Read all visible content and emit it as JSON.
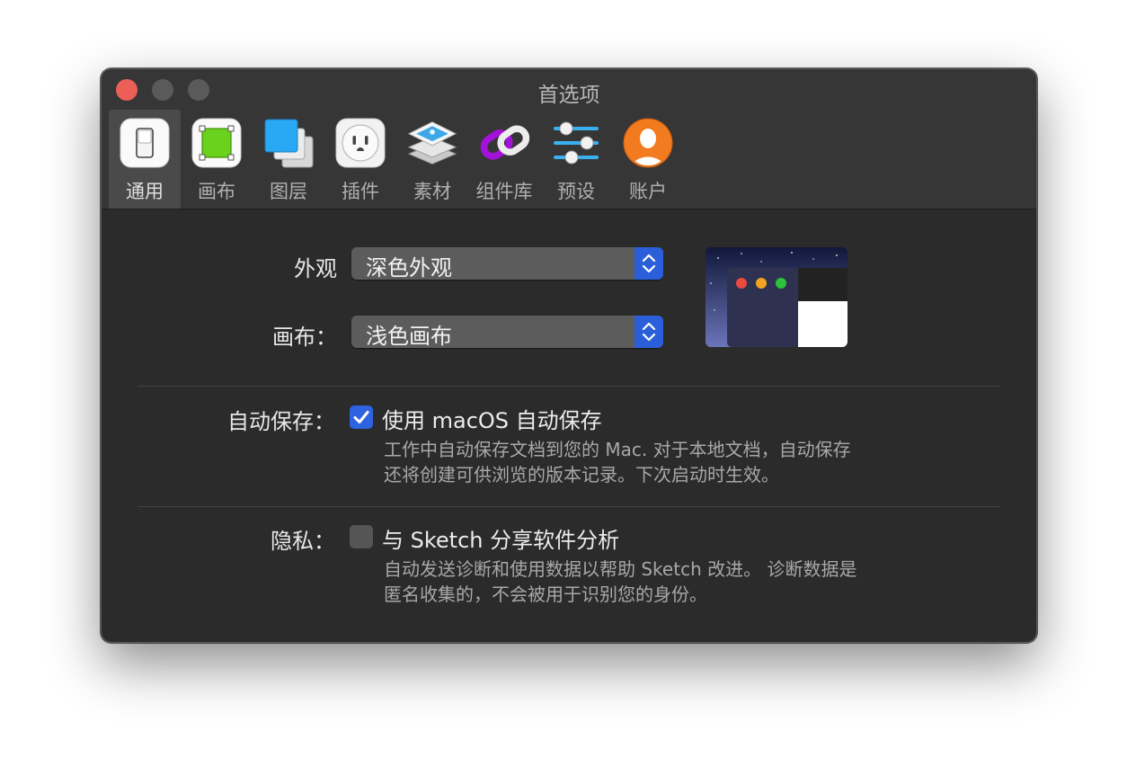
{
  "window": {
    "title": "首选项"
  },
  "tabs": [
    {
      "label": "通用",
      "icon": "switch-icon",
      "active": true
    },
    {
      "label": "画布",
      "icon": "canvas-icon",
      "active": false
    },
    {
      "label": "图层",
      "icon": "layers-icon",
      "active": false
    },
    {
      "label": "插件",
      "icon": "plugin-icon",
      "active": false
    },
    {
      "label": "素材",
      "icon": "assets-icon",
      "active": false
    },
    {
      "label": "组件库",
      "icon": "library-icon",
      "active": false
    },
    {
      "label": "预设",
      "icon": "presets-icon",
      "active": false
    },
    {
      "label": "账户",
      "icon": "account-icon",
      "active": false
    }
  ],
  "appearance": {
    "label": "外观",
    "value": "深色外观"
  },
  "canvas": {
    "label": "画布：",
    "value": "浅色画布"
  },
  "autosave": {
    "label": "自动保存：",
    "checkbox_label": "使用 macOS 自动保存",
    "checked": true,
    "desc_line1": "工作中自动保存文档到您的 Mac. 对于本地文档，自动保存",
    "desc_line2": "还将创建可供浏览的版本记录。下次启动时生效。"
  },
  "privacy": {
    "label": "隐私：",
    "checkbox_label": "与 Sketch 分享软件分析",
    "checked": false,
    "desc_line1": "自动发送诊断和使用数据以帮助 Sketch 改进。 诊断数据是",
    "desc_line2": "匿名收集的，不会被用于识别您的身份。"
  },
  "colors": {
    "accent": "#2b5fd9",
    "close": "#ec5f57",
    "window_bg": "#2b2b2b"
  }
}
